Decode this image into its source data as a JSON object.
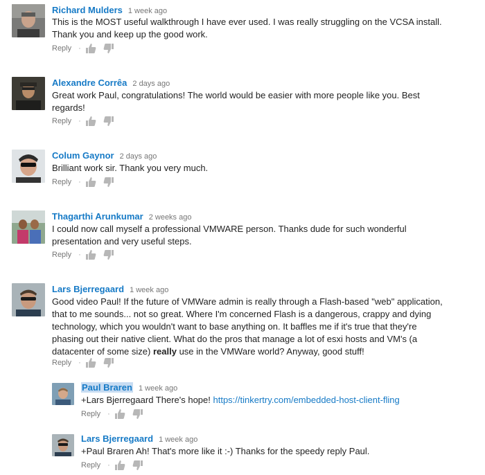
{
  "comments": [
    {
      "author": "Richard Mulders",
      "time": "1 week ago",
      "text": "This is the MOST useful walkthrough I have ever used.  I was really struggling on the VCSA install. Thank you and keep up the good work.",
      "reply_label": "Reply"
    },
    {
      "author": "Alexandre Corrêa",
      "time": "2 days ago",
      "text": "Great work Paul, congratulations! The world would be easier with more people like you. Best regards!",
      "reply_label": "Reply"
    },
    {
      "author": "Colum Gaynor",
      "time": "2 days ago",
      "text": "Brilliant work sir. Thank you very much.",
      "reply_label": "Reply"
    },
    {
      "author": "Thagarthi Arunkumar",
      "time": "2 weeks ago",
      "text": "I could now call myself a professional VMWARE person. Thanks dude for such wonderful presentation and very useful steps.",
      "reply_label": "Reply"
    },
    {
      "author": "Lars Bjerregaard",
      "time": "1 week ago",
      "text_before": "Good video Paul! If the future of VMWare admin is really through a Flash-based \"web\" application, that to me sounds... not so great. Where I'm concerned Flash is a dangerous, crappy and dying technology, which you wouldn't want to base anything on. It baffles me if it's true that they're phasing out their native client. What do the pros that manage a lot of esxi hosts and VM's (a datacenter of some size) ",
      "text_bold": "really",
      "text_after": " use in the VMWare world? Anyway, good stuff!",
      "reply_label": "Reply"
    }
  ],
  "replies": [
    {
      "author": "Paul Braren",
      "time": "1 week ago",
      "text": "+Lars Bjerregaard There's hope! ",
      "link": "https://tinkertry.com/embedded-host-client-fling",
      "reply_label": "Reply"
    },
    {
      "author": "Lars Bjerregaard",
      "time": "1 week ago",
      "text": "+Paul Braren Ah! That's more like it :-) Thanks for the speedy reply Paul.",
      "reply_label": "Reply"
    }
  ],
  "separator": "·",
  "colors": {
    "author": "#167ac6",
    "meta": "#767676",
    "text": "#222222",
    "highlight": "#c7dcf2"
  }
}
